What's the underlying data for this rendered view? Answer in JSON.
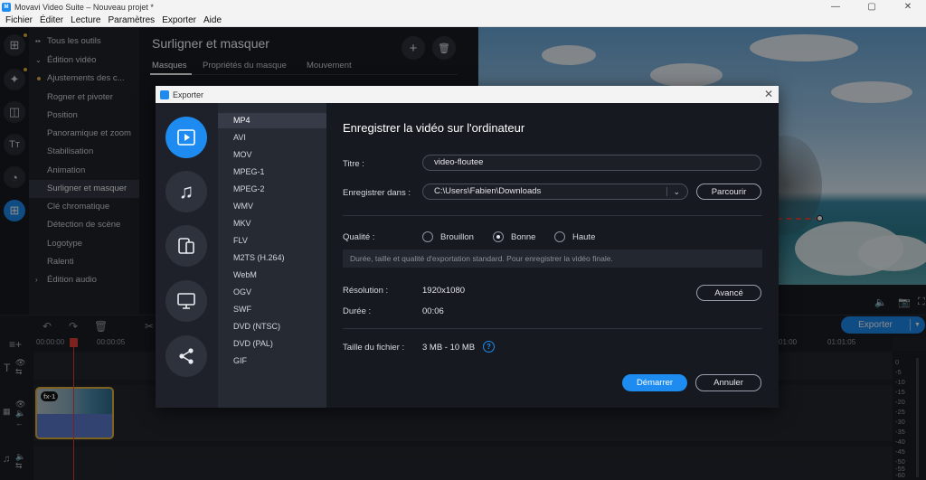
{
  "window": {
    "title": "Movavi Video Suite – Nouveau projet *",
    "app_icon_text": "M"
  },
  "menu": [
    "Fichier",
    "Éditer",
    "Lecture",
    "Paramètres",
    "Exporter",
    "Aide"
  ],
  "sidebar": {
    "items": [
      {
        "label": "Tous les outils",
        "prefix": "grid"
      },
      {
        "label": "Édition vidéo",
        "prefix": "chevron-down"
      },
      {
        "label": "Ajustements des c...",
        "prefix": "dot"
      },
      {
        "label": "Rogner et pivoter"
      },
      {
        "label": "Position"
      },
      {
        "label": "Panoramique et zoom"
      },
      {
        "label": "Stabilisation"
      },
      {
        "label": "Animation"
      },
      {
        "label": "Surligner et masquer",
        "active": true
      },
      {
        "label": "Clé chromatique"
      },
      {
        "label": "Détection de scène"
      },
      {
        "label": "Logotype"
      },
      {
        "label": "Ralenti"
      },
      {
        "label": "Édition audio",
        "prefix": "chevron-right"
      }
    ]
  },
  "props": {
    "title": "Surligner et masquer",
    "tabs": [
      "Masques",
      "Propriétés du masque",
      "Mouvement"
    ],
    "add_glyph": "+",
    "delete_glyph": "🗑"
  },
  "timeline": {
    "ruler_labels": [
      "00:00:00",
      "00:00:05",
      "01:00",
      "01:01:05"
    ],
    "clip_badge": "fx·1",
    "export_label": "Exporter",
    "meter_labels": [
      "0",
      "-5",
      "-10",
      "-15",
      "-20",
      "-25",
      "-30",
      "-35",
      "-40",
      "-45",
      "-50",
      "-55",
      "-60"
    ]
  },
  "dialog": {
    "title": "Exporter",
    "heading": "Enregistrer la vidéo sur l'ordinateur",
    "categories": [
      {
        "icon": "video-icon",
        "active": true
      },
      {
        "icon": "music-icon"
      },
      {
        "icon": "devices-icon"
      },
      {
        "icon": "monitor-icon"
      },
      {
        "icon": "share-icon"
      }
    ],
    "formats": [
      "MP4",
      "AVI",
      "MOV",
      "MPEG-1",
      "MPEG-2",
      "WMV",
      "MKV",
      "FLV",
      "M2TS (H.264)",
      "WebM",
      "OGV",
      "SWF",
      "DVD (NTSC)",
      "DVD (PAL)",
      "GIF"
    ],
    "selected_format": "MP4",
    "title_label": "Titre :",
    "title_value": "video-floutee",
    "save_label": "Enregistrer dans :",
    "save_path": "C:\\Users\\Fabien\\Downloads",
    "browse_label": "Parcourir",
    "quality_label": "Qualité :",
    "quality_options": [
      "Brouillon",
      "Bonne",
      "Haute"
    ],
    "quality_selected": "Bonne",
    "quality_note": "Durée, taille et qualité d'exportation standard. Pour enregistrer la vidéo finale.",
    "resolution_label": "Résolution :",
    "resolution_value": "1920x1080",
    "advanced_label": "Avancé",
    "duration_label": "Durée :",
    "duration_value": "00:06",
    "filesize_label": "Taille du fichier :",
    "filesize_value": "3 MB - 10 MB",
    "start_label": "Démarrer",
    "cancel_label": "Annuler"
  },
  "colors": {
    "accent": "#1e8bf0",
    "highlight": "#e8b23a",
    "playhead": "#e3403a"
  }
}
